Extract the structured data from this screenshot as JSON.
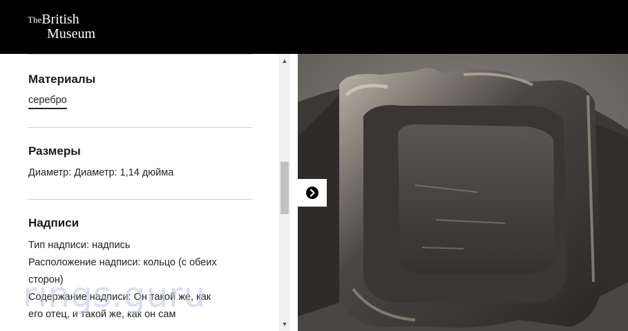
{
  "header": {
    "logo_the": "The",
    "logo_british": "British",
    "logo_museum": "Museum"
  },
  "sections": {
    "materials": {
      "title": "Материалы",
      "link": "серебро"
    },
    "dimensions": {
      "title": "Размеры",
      "text": "Диаметр: Диаметр: 1,14 дюйма"
    },
    "inscriptions": {
      "title": "Надписи",
      "type": "Тип надписи: надпись",
      "position_line1": "Расположение надписи: кольцо (с обеих",
      "position_line2": "сторон)",
      "content_line1": "Содержание надписи: Он такой же, как",
      "content_line2": "его отец, и такой же, как он сам"
    }
  },
  "image": {
    "alt": "silver ring close-up"
  },
  "watermark": "rings.guru"
}
